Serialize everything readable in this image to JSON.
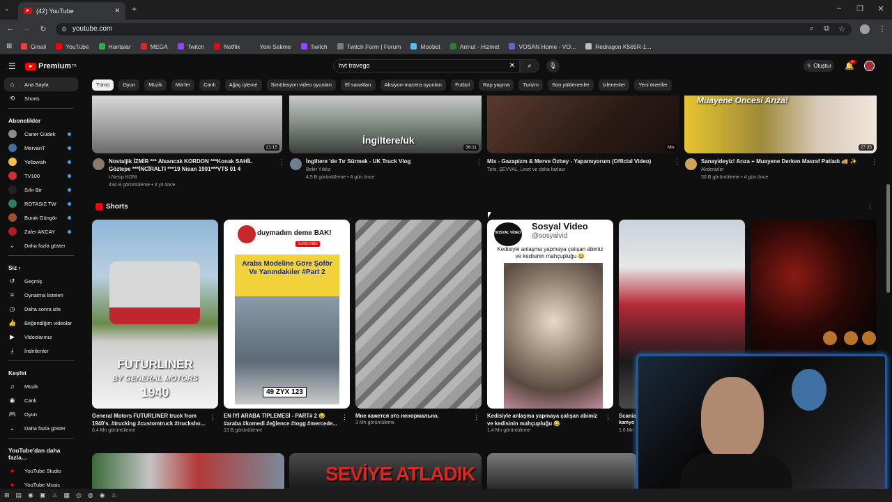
{
  "browser": {
    "tab_title": "(42) YouTube",
    "url": "youtube.com",
    "bookmarks": [
      {
        "label": "Gmail",
        "color": "#ea4335"
      },
      {
        "label": "YouTube",
        "color": "#ff0000"
      },
      {
        "label": "Haritalar",
        "color": "#34a853"
      },
      {
        "label": "MEGA",
        "color": "#d9272e"
      },
      {
        "label": "Twitch",
        "color": "#9146ff"
      },
      {
        "label": "Netflix",
        "color": "#e50914"
      },
      {
        "label": "Yeni Sekme",
        "color": "#35363a"
      },
      {
        "label": "Twitch",
        "color": "#9146ff"
      },
      {
        "label": "Twitch Form | Forum",
        "color": "#7d7d7d"
      },
      {
        "label": "Moobot",
        "color": "#4fc3f7"
      },
      {
        "label": "Armut - Hizmet",
        "color": "#2e7d32"
      },
      {
        "label": "VOSAN Home - VO...",
        "color": "#5c6bc0"
      },
      {
        "label": "Redragon K565R-1...",
        "color": "#bdbdbd"
      }
    ]
  },
  "youtube": {
    "logo": "Premium",
    "logo_region": "TR",
    "search_query": "hvt travego",
    "create_label": "Oluştur",
    "notification_count": "9+",
    "chips": [
      "Tümü",
      "Oyun",
      "Müzik",
      "Mix'ler",
      "Canlı",
      "Ağaç işleme",
      "Simülasyon video oyunları",
      "El sanatları",
      "Aksiyon-macera oyunları",
      "Futbol",
      "Rap yapma",
      "Turizm",
      "Son yüklenenler",
      "İzlenenler",
      "Yeni öneriler"
    ]
  },
  "sidebar": {
    "main": [
      {
        "label": "Ana Sayfa",
        "icon": "home-icon",
        "glyph": "⌂"
      },
      {
        "label": "Shorts",
        "icon": "shorts-icon",
        "glyph": "⟲"
      }
    ],
    "subscriptions_header": "Abonelikler",
    "subscriptions": [
      {
        "label": "Caner Güdek",
        "color": "#8d8d8d"
      },
      {
        "label": "MervanT",
        "color": "#3d6fa3"
      },
      {
        "label": "Yellowish",
        "color": "#f2c14e"
      },
      {
        "label": "TV100",
        "color": "#d32f2f"
      },
      {
        "label": "Sıfır Bir",
        "color": "#222222"
      },
      {
        "label": "ROTASIZ TW",
        "color": "#2e7d5b"
      },
      {
        "label": "Burak Güngör",
        "color": "#a0522d"
      },
      {
        "label": "Zafer AKCAY",
        "color": "#b71c1c"
      }
    ],
    "show_more": "Daha fazla göster",
    "you_header": "Siz",
    "you_items": [
      {
        "label": "Geçmiş",
        "glyph": "↺"
      },
      {
        "label": "Oynatma listeleri",
        "glyph": "≡"
      },
      {
        "label": "Daha sonra izle",
        "glyph": "◷"
      },
      {
        "label": "Beğendiğim videolar",
        "glyph": "👍"
      },
      {
        "label": "Videolarınız",
        "glyph": "▶"
      },
      {
        "label": "İndirilenler",
        "glyph": "⤓"
      }
    ],
    "explore_header": "Keşfet",
    "explore_items": [
      {
        "label": "Müzik",
        "glyph": "♫"
      },
      {
        "label": "Canlı",
        "glyph": "◉"
      },
      {
        "label": "Oyun",
        "glyph": "🎮"
      }
    ],
    "show_more_2": "Daha fazla göster",
    "more_header": "YouTube'dan daha fazla...",
    "more_items": [
      {
        "label": "YouTube Studio"
      },
      {
        "label": "YouTube Music"
      }
    ]
  },
  "videos": [
    {
      "title": "Nostaljik İZMİR *** Alsancak KORDON ***Konak SAHİL Göztepe ***İNCİRALTI ***19 Nisan 1991***VTS 01 4",
      "channel": "I.Necip KONI",
      "meta": "434 B görüntüleme • 3 yıl önce",
      "duration": "21:15"
    },
    {
      "title": "İngiltere 'de Tır Sürmek - UK Truck Vlog",
      "channel": "Bekir Yıldız",
      "meta": "4,5 B görüntüleme • 4 gün önce",
      "duration": "38:11",
      "overlay": "İngiltere/uk"
    },
    {
      "title": "Mix - Gazapizm & Merve Özbey - Yapamıyorum (Official Video)",
      "channel": "Tefo, ŞEVVAL, Linet ve daha fazlası",
      "meta": "",
      "duration": "Mix"
    },
    {
      "title": "Sanayideyiz! Arıza + Muayene Derken Masraf Patladı 🚚 ✨",
      "channel": "Akdenizler",
      "meta": "30 B görüntüleme • 4 gün önce",
      "duration": "27:35",
      "overlay": "Muayene Oncesi Arıza!"
    }
  ],
  "shorts_section": {
    "title": "Shorts",
    "items": [
      {
        "title": "General Motors FUTURLINER truck from 1940's. #trucking #customtruck #truckshо...",
        "views": "6,4 Mn görüntüleme",
        "overlay1": "FUTURLINER",
        "overlay2": "BY GENERAL MOTORS",
        "overlay3": "1940"
      },
      {
        "title": "EN İYİ ARABA TİPLEMESİ - PART# 2 😂 #araba #komedi #eğlence #togg #mercede...",
        "views": "13 B görüntüleme",
        "overlay1": "duymadım deme BAK!",
        "overlay2": "Araba Modeline Göre Şoför Ve Yanındakiler #Part 2",
        "plate": "49 ZYX 123",
        "subscribe": "SUBSCRIBE"
      },
      {
        "title": "Мне кажется это ненормально.",
        "views": "3 Mn görüntüleme"
      },
      {
        "title": "Kedisiyle anlaşma yapmaya çalışan abimiz ve kedisinin mahçupluğu 😂",
        "views": "1,4 Mn görüntüleme",
        "overlay1": "Sosyal Video",
        "overlay2": "@sosyalvid",
        "overlay3": "Kedisiyle anlaşma yapmaya çalışan abimiz ve kedisinin mahçupluğu 😂",
        "logo": "SOSYAL VİDEO"
      },
      {
        "title": "Scania",
        "views": "1,6 Mn",
        "overlay1": "kamyo"
      },
      {
        "title": "",
        "views": ""
      }
    ]
  },
  "bottom_row": {
    "overlay": "SEVİYE ATLADIK"
  }
}
